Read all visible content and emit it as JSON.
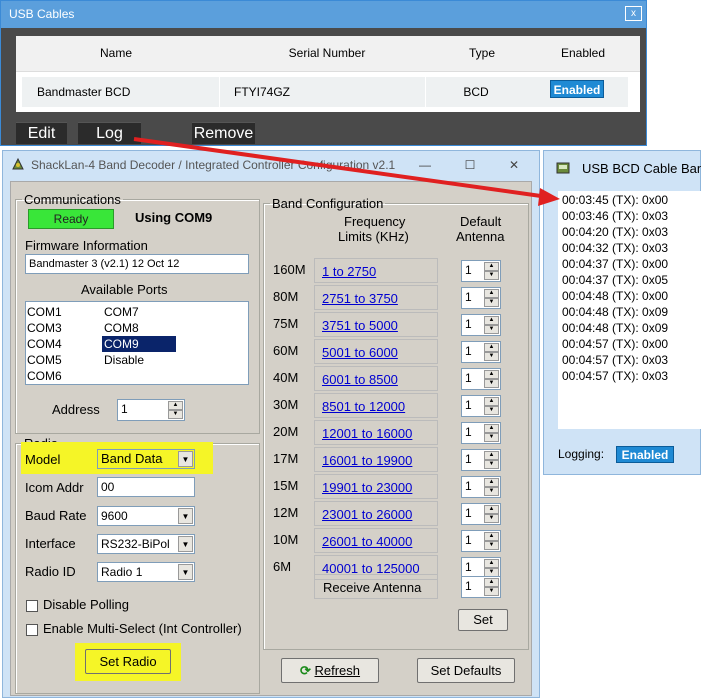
{
  "usb_window": {
    "title": "USB Cables",
    "close_label": "x",
    "columns": [
      "Name",
      "Serial Number",
      "Type",
      "Enabled"
    ],
    "row": {
      "name": "Bandmaster BCD",
      "serial": "FTYI74GZ",
      "type": "BCD",
      "enabled": "Enabled"
    },
    "buttons": {
      "edit": "Edit",
      "log": "Log",
      "remove": "Remove"
    }
  },
  "config_window": {
    "title": "ShackLan-4 Band Decoder / Integrated Controller Configuration v2.1",
    "controls": {
      "minimize": "—",
      "maximize": "☐",
      "close": "✕"
    },
    "communications": {
      "legend": "Communications",
      "status": "Ready",
      "using": "Using COM9",
      "firmware_label": "Firmware Information",
      "firmware_value": "Bandmaster 3 (v2.1) 12 Oct 12",
      "ports_label": "Available Ports",
      "ports_col1": [
        "COM1",
        "COM3",
        "COM4",
        "COM5",
        "COM6"
      ],
      "ports_col2": [
        "COM7",
        "COM8",
        "COM9",
        "Disable"
      ],
      "selected_port": "COM9",
      "address_label": "Address",
      "address_value": "1"
    },
    "radio": {
      "legend": "Radio",
      "model_label": "Model",
      "model_value": "Band Data",
      "icom_label": "Icom Addr",
      "icom_value": "00",
      "baud_label": "Baud Rate",
      "baud_value": "9600",
      "interface_label": "Interface",
      "interface_value": "RS232-BiPol",
      "radio_id_label": "Radio ID",
      "radio_id_value": "Radio 1",
      "disable_polling": "Disable Polling",
      "multi_select": "Enable Multi-Select (Int Controller)",
      "set_radio": "Set Radio"
    },
    "band": {
      "legend": "Band Configuration",
      "freq_header_1": "Frequency",
      "freq_header_2": "Limits (KHz)",
      "ant_header_1": "Default",
      "ant_header_2": "Antenna",
      "rows": [
        {
          "band": "160M",
          "range": "1 to 2750",
          "antenna": "1"
        },
        {
          "band": "80M",
          "range": "2751 to 3750",
          "antenna": "1"
        },
        {
          "band": "75M",
          "range": "3751 to 5000",
          "antenna": "1"
        },
        {
          "band": "60M",
          "range": "5001 to 6000",
          "antenna": "1"
        },
        {
          "band": "40M",
          "range": "6001 to 8500",
          "antenna": "1"
        },
        {
          "band": "30M",
          "range": "8501 to 12000",
          "antenna": "1"
        },
        {
          "band": "20M",
          "range": "12001 to 16000",
          "antenna": "1"
        },
        {
          "band": "17M",
          "range": "16001 to 19900",
          "antenna": "1"
        },
        {
          "band": "15M",
          "range": "19901 to 23000",
          "antenna": "1"
        },
        {
          "band": "12M",
          "range": "23001 to 26000",
          "antenna": "1"
        },
        {
          "band": "10M",
          "range": "26001 to 40000",
          "antenna": "1"
        },
        {
          "band": "6M",
          "range": "40001 to 125000",
          "antenna": "1"
        }
      ],
      "receive_label": "Receive Antenna",
      "receive_value": "1",
      "set": "Set"
    },
    "refresh": "Refresh",
    "set_defaults": "Set Defaults"
  },
  "log_window": {
    "title": "USB BCD Cable Bandm",
    "lines": [
      "00:03:45 (TX): 0x00",
      "00:03:46 (TX): 0x03",
      "00:04:20 (TX): 0x03",
      "00:04:32 (TX): 0x03",
      "00:04:37 (TX): 0x00",
      "00:04:37 (TX): 0x05",
      "00:04:48 (TX): 0x00",
      "00:04:48 (TX): 0x09",
      "00:04:48 (TX): 0x09",
      "00:04:57 (TX): 0x00",
      "00:04:57 (TX): 0x03",
      "00:04:57 (TX): 0x03"
    ],
    "logging_label": "Logging:",
    "logging_value": "Enabled"
  },
  "colors": {
    "accent": "#1f8ad4",
    "highlight": "#f5f527",
    "ready_green": "#39e639",
    "arrow_red": "#e02020"
  }
}
